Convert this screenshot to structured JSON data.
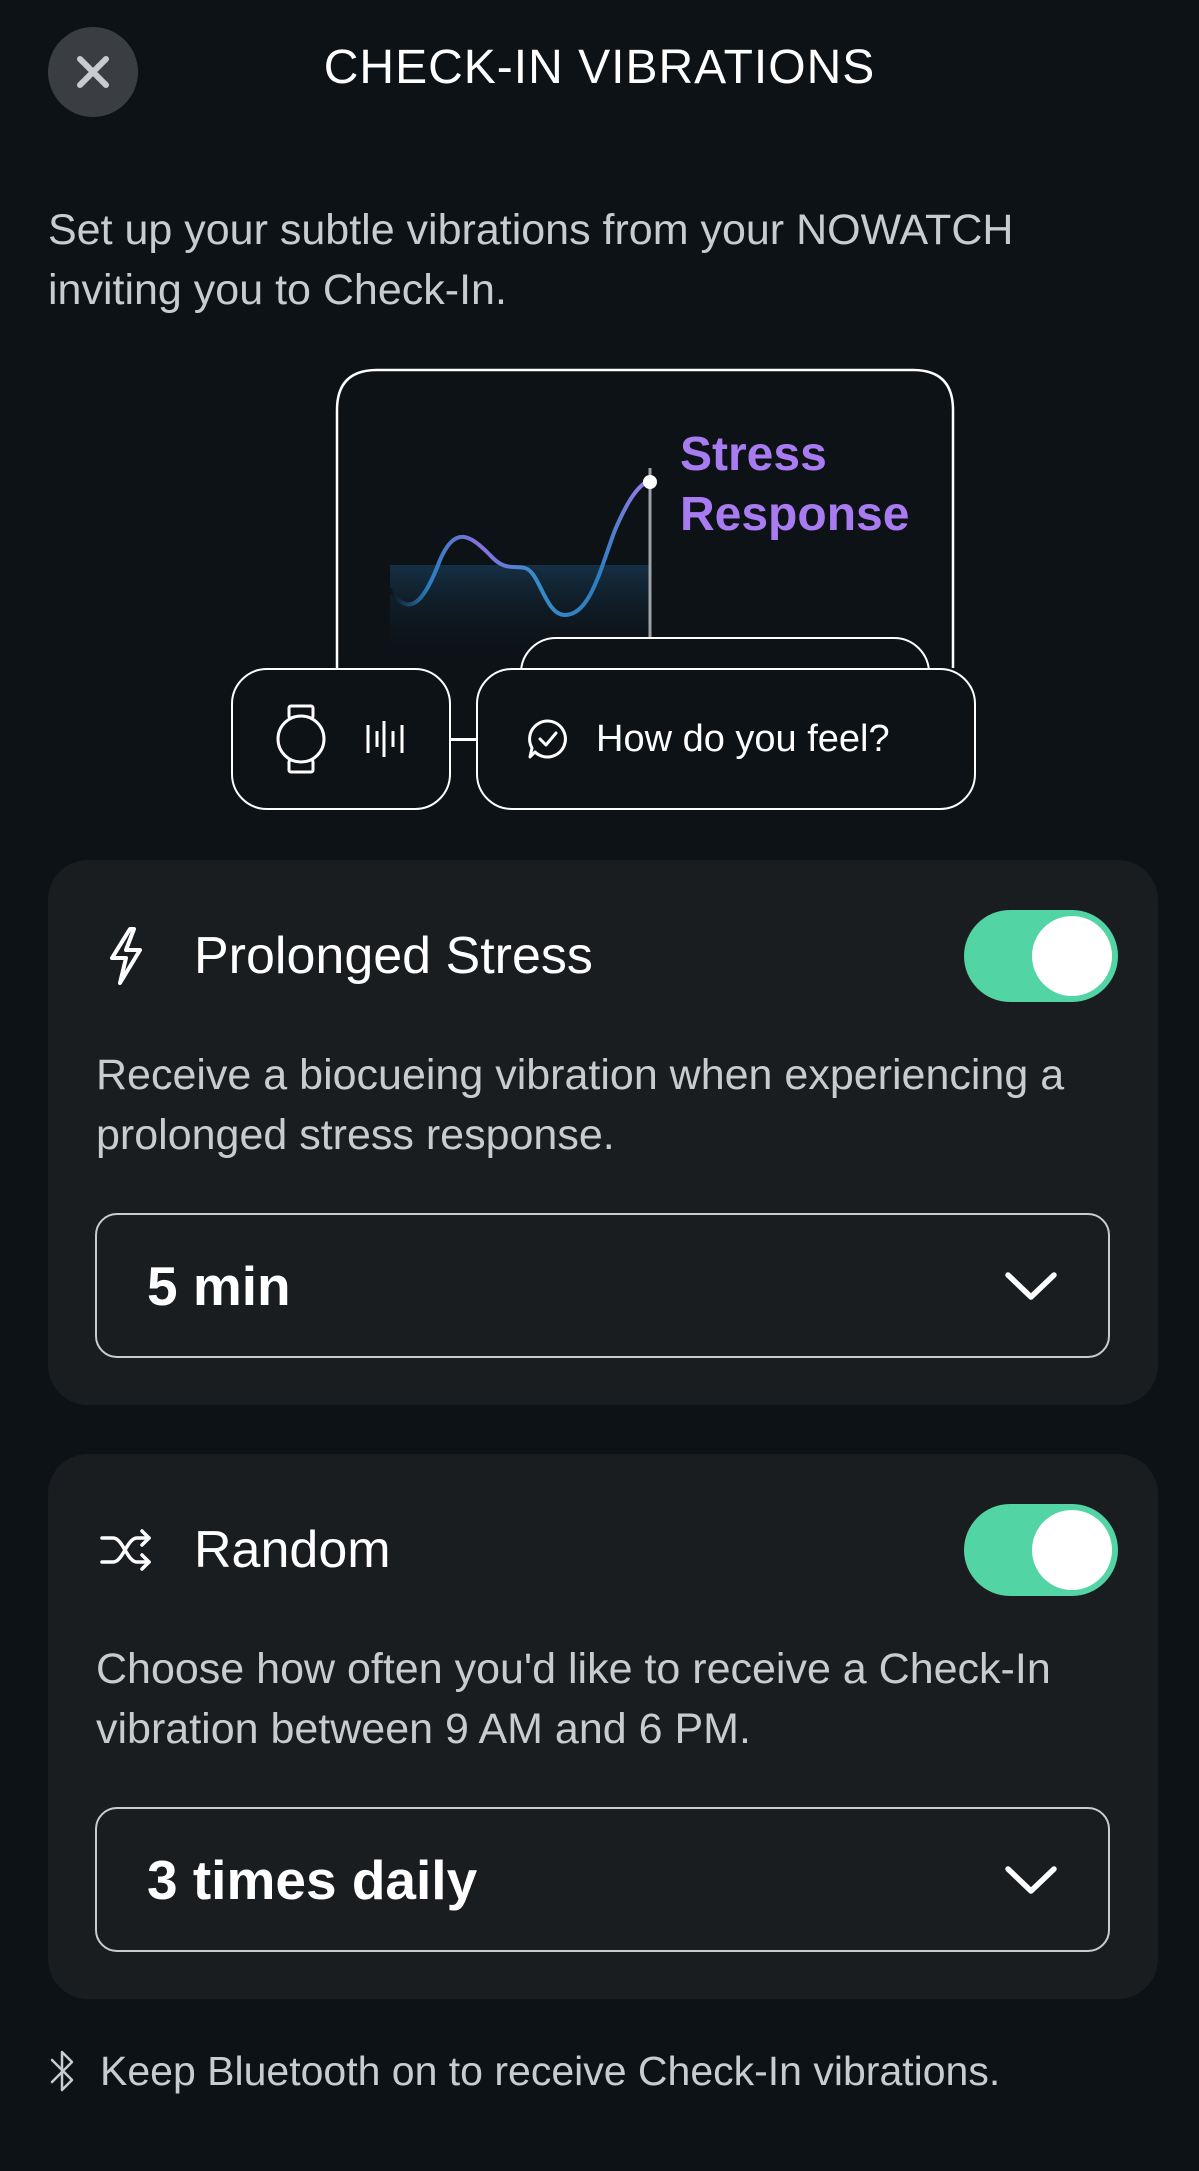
{
  "header": {
    "title": "CHECK-IN VIBRATIONS",
    "close_icon": "close-icon"
  },
  "intro": "Set up your subtle vibrations from your NOWATCH inviting you to Check-In.",
  "illustration": {
    "label": "Stress Response",
    "message": "How do you feel?",
    "icons": [
      "watch-icon",
      "vibration-icon",
      "chat-check-icon"
    ]
  },
  "cards": [
    {
      "icon": "lightning-icon",
      "title": "Prolonged Stress",
      "enabled": true,
      "description": "Receive a biocueing vibration when experiencing a prolonged stress response.",
      "selected": "5 min"
    },
    {
      "icon": "shuffle-icon",
      "title": "Random",
      "enabled": true,
      "description": "Choose how often you'd like to receive a Check-In vibration between 9 AM and 6 PM.",
      "selected": "3 times daily"
    }
  ],
  "footer": {
    "icon": "bluetooth-icon",
    "text": "Keep Bluetooth on to receive Check-In vibrations."
  },
  "colors": {
    "background": "#0c1216",
    "card": "#1a1d20",
    "toggle_on": "#52d4a4",
    "accent_purple": "#a97bf0",
    "accent_blue": "#2a7fc0"
  }
}
